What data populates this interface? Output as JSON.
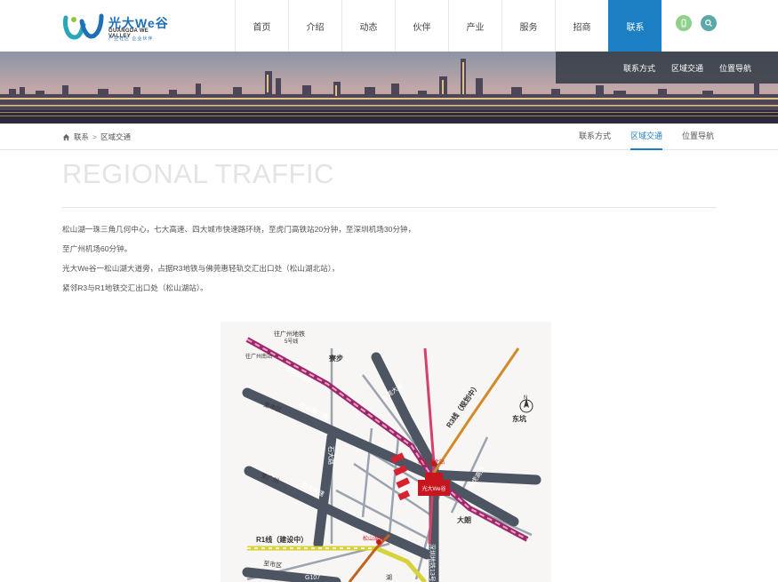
{
  "header": {
    "logo_cn": "光大We谷",
    "logo_en": "GUANGDA WE VALLEY",
    "logo_sub": "产业社区  企业伙伴",
    "nav": [
      {
        "label": "首页"
      },
      {
        "label": "介绍"
      },
      {
        "label": "动态"
      },
      {
        "label": "伙伴"
      },
      {
        "label": "产业"
      },
      {
        "label": "服务"
      },
      {
        "label": "招商"
      },
      {
        "label": "联系",
        "active": true
      }
    ],
    "icons": [
      "phone-icon",
      "search-icon"
    ],
    "accent_color": "#1c7fc4"
  },
  "banner": {
    "subnav": [
      "联系方式",
      "区域交通",
      "位置导航"
    ]
  },
  "breadcrumb": {
    "items": [
      "联系",
      "区域交通"
    ],
    "separator": ">"
  },
  "tabs": [
    {
      "label": "联系方式"
    },
    {
      "label": "区域交通",
      "active": true
    },
    {
      "label": "位置导航"
    }
  ],
  "content": {
    "heading": "REGIONAL TRAFFIC",
    "paragraphs": [
      "松山湖一珠三角几何中心，七大高速、四大城市快速路环绕，至虎门高铁站20分钟，至深圳机场30分钟，",
      "至广州机场60分钟。",
      "光大We谷一松山湖大道旁，占据R3地铁与佛莞惠轻轨交汇出口处（松山湖北站），",
      "紧邻R3与R1地铁交汇出口处（松山湖站）。"
    ]
  },
  "map": {
    "labels": {
      "guangzhou_metro": "往广州地铁",
      "line5": "5号线",
      "guangzhou_south": "往广州南站",
      "foguanhui": "佛莞惠城轨",
      "liaobu": "寮步",
      "dongguan": "东莞大道",
      "r3": "R3线（规划中）",
      "north_arrow": "N",
      "dongkeng": "东坑",
      "to_city1": "至市区",
      "songshanhu_ave": "松山湖大道",
      "songshanhu_north": "松山湖北站",
      "shida": "石大路",
      "to_guangzhou": "至广州",
      "guanshen": "莞深高速",
      "changhu": "常虎高速",
      "logo_small": "光大We谷",
      "dalang": "大朗",
      "r1": "R1线（建设中）",
      "songshanhu_station": "松山湖站",
      "shenzhen_metro": "深圳地铁13号线",
      "to_city2": "至市区",
      "g107": "G107",
      "hu": "湖"
    }
  }
}
